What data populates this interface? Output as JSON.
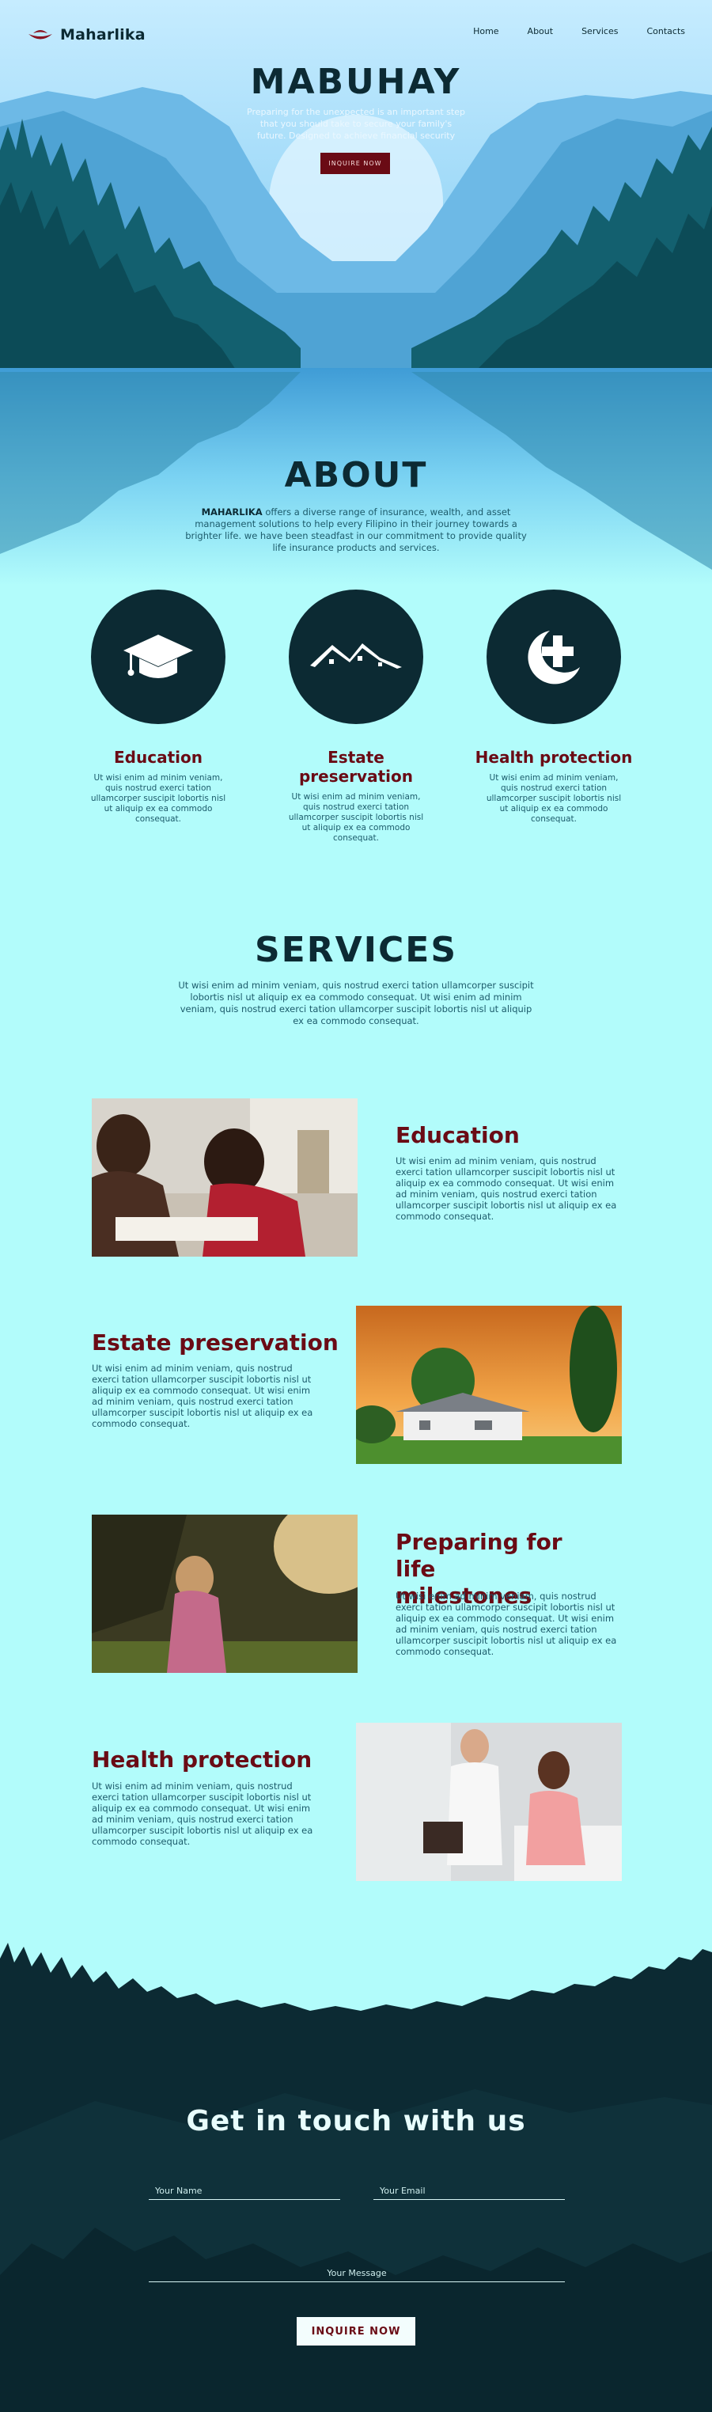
{
  "brand": {
    "name": "Maharlika"
  },
  "nav": {
    "links": [
      "Home",
      "About",
      "Services",
      "Contacts"
    ]
  },
  "hero": {
    "title": "MABUHAY",
    "subtitle": "Preparing for the unexpected is an important step that you should take to secure your family's future. Designed to achieve financial security",
    "button": "INQUIRE NOW"
  },
  "about": {
    "title": "ABOUT",
    "brand_word": "MAHARLIKA",
    "text": " offers a diverse range of insurance, wealth, and asset management solutions to help every Filipino in their journey towards a brighter life. we have been steadfast in our commitment to provide quality life insurance products and services.",
    "features": [
      {
        "title": "Education",
        "icon": "graduation-cap-icon",
        "desc": "Ut wisi enim ad minim veniam, quis nostrud exerci tation ullamcorper suscipit lobortis nisl ut aliquip ex ea commodo consequat."
      },
      {
        "title": "Estate preservation",
        "icon": "houses-icon",
        "desc": "Ut wisi enim ad minim veniam, quis nostrud exerci tation ullamcorper suscipit lobortis nisl ut aliquip ex ea commodo consequat."
      },
      {
        "title": "Health protection",
        "icon": "moon-plus-icon",
        "desc": "Ut wisi enim ad minim veniam, quis nostrud exerci tation ullamcorper suscipit lobortis nisl ut aliquip ex ea commodo consequat."
      }
    ]
  },
  "services": {
    "title": "SERVICES",
    "desc": "Ut wisi enim ad minim veniam, quis nostrud exerci tation ullamcorper suscipit lobortis nisl ut aliquip ex ea commodo consequat. Ut wisi enim ad minim veniam, quis nostrud exerci tation ullamcorper suscipit lobortis nisl ut aliquip ex ea commodo consequat.",
    "items": [
      {
        "title": "Education",
        "text": "Ut wisi enim ad minim veniam, quis nostrud exerci tation ullamcorper suscipit lobortis nisl ut aliquip ex ea commodo consequat. Ut wisi enim ad minim veniam, quis nostrud exerci tation ullamcorper suscipit lobortis nisl ut aliquip ex ea commodo consequat."
      },
      {
        "title": "Estate preservation",
        "text": "Ut wisi enim ad minim veniam, quis nostrud exerci tation ullamcorper suscipit lobortis nisl ut aliquip ex ea commodo consequat. Ut wisi enim ad minim veniam, quis nostrud exerci tation ullamcorper suscipit lobortis nisl ut aliquip ex ea commodo consequat."
      },
      {
        "title": "Preparing for life milestones",
        "text": "Ut wisi enim ad minim veniam, quis nostrud exerci tation ullamcorper suscipit lobortis nisl ut aliquip ex ea commodo consequat. Ut wisi enim ad minim veniam, quis nostrud exerci tation ullamcorper suscipit lobortis nisl ut aliquip ex ea commodo consequat."
      },
      {
        "title": "Health protection",
        "text": "Ut wisi enim ad minim veniam, quis nostrud exerci tation ullamcorper suscipit lobortis nisl ut aliquip ex ea commodo consequat. Ut wisi enim ad minim veniam, quis nostrud exerci tation ullamcorper suscipit lobortis nisl ut aliquip ex ea commodo consequat."
      }
    ]
  },
  "contact": {
    "title": "Get in touch with us",
    "name_placeholder": "Your Name",
    "email_placeholder": "Your Email",
    "message_placeholder": "Your Message",
    "button": "INQUIRE NOW"
  },
  "colors": {
    "accent": "#6a0b15",
    "dark": "#0c2a33",
    "background": "#b2fcfb"
  }
}
